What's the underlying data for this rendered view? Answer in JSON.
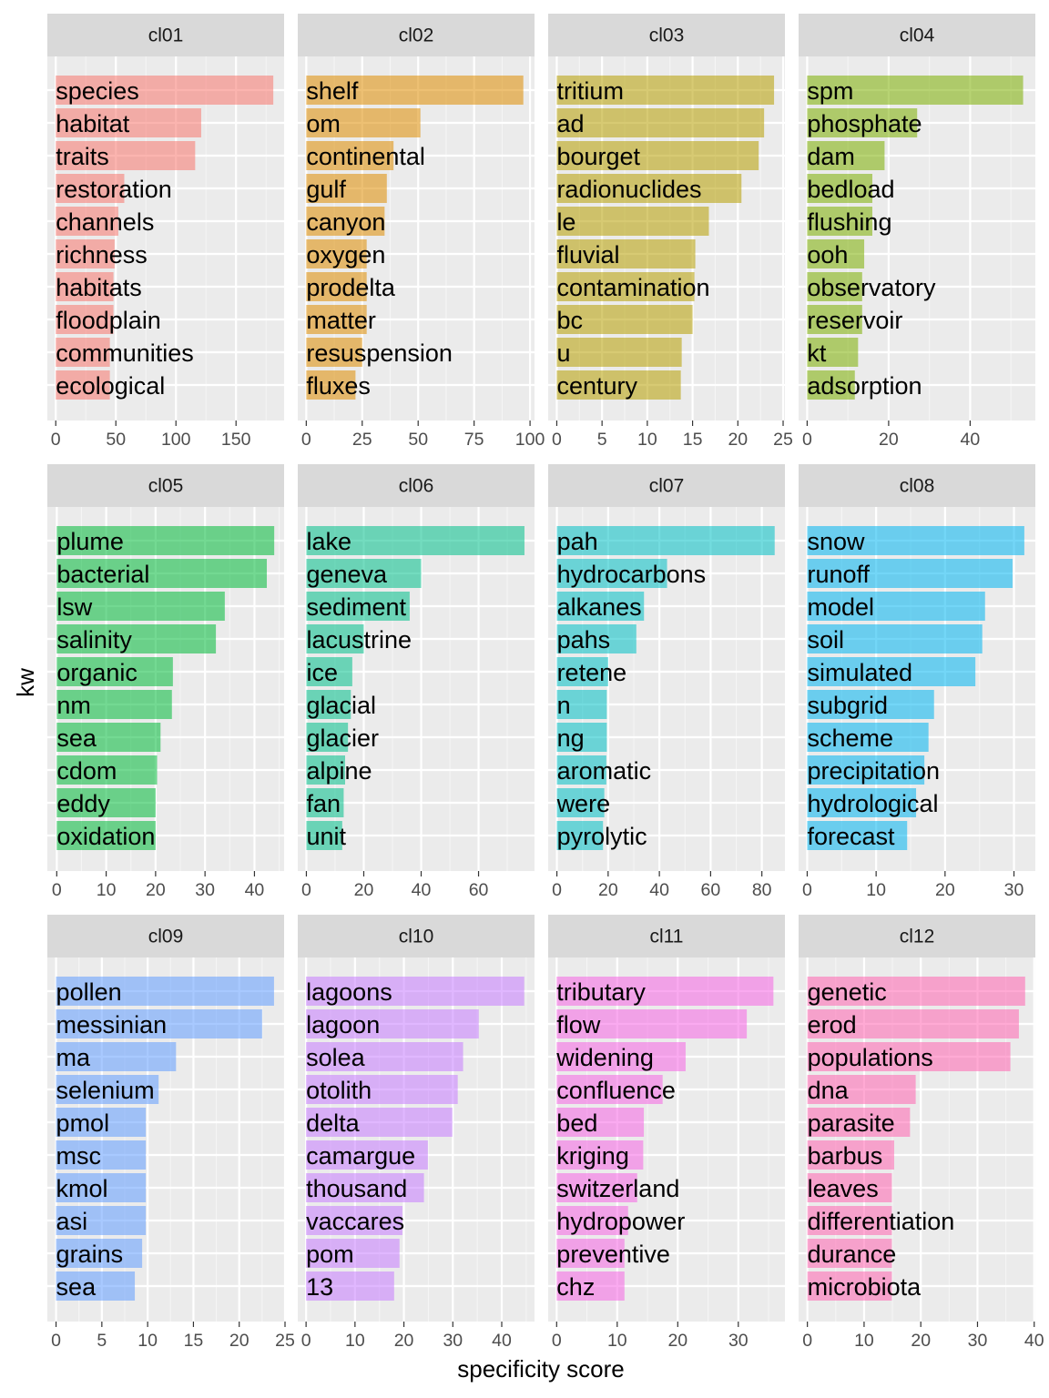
{
  "chart_data": {
    "type": "bar",
    "orientation": "horizontal",
    "xlabel": "specificity score",
    "ylabel": "kw",
    "grid": true,
    "facet_colors": [
      "#F8766D",
      "#DE8C00",
      "#B79F00",
      "#7CAE00",
      "#00BA38",
      "#00C08B",
      "#00BFC4",
      "#00B4F0",
      "#619CFF",
      "#C77CFF",
      "#F564E3",
      "#FF64B0"
    ],
    "panels": [
      {
        "name": "cl01",
        "xlim": [
          -7,
          190
        ],
        "xticks": [
          0,
          50,
          100,
          150
        ],
        "xtick_labels": [
          "0",
          "50",
          "100",
          "150"
        ],
        "categories": [
          "species",
          "habitat",
          "traits",
          "restoration",
          "channels",
          "richness",
          "habitats",
          "floodplain",
          "communities",
          "ecological"
        ],
        "values": [
          181,
          121,
          116,
          57,
          52,
          49,
          48,
          48,
          45,
          45
        ]
      },
      {
        "name": "cl02",
        "xlim": [
          -3.8,
          102
        ],
        "xticks": [
          0,
          25,
          50,
          75,
          100
        ],
        "xtick_labels": [
          "0",
          "25",
          "50",
          "75",
          "100"
        ],
        "categories": [
          "shelf",
          "om",
          "continental",
          "gulf",
          "canyon",
          "oxygen",
          "prodelta",
          "matter",
          "resuspension",
          "fluxes"
        ],
        "values": [
          97,
          51,
          39,
          36,
          35,
          27,
          27,
          27,
          25,
          22
        ]
      },
      {
        "name": "cl03",
        "xlim": [
          -0.95,
          25.2
        ],
        "xticks": [
          0,
          5,
          10,
          15,
          20,
          25
        ],
        "xtick_labels": [
          "0",
          "5",
          "10",
          "15",
          "20",
          "25"
        ],
        "categories": [
          "tritium",
          "ad",
          "bourget",
          "radionuclides",
          "le",
          "fluvial",
          "contamination",
          "bc",
          "u",
          "century"
        ],
        "values": [
          24,
          22.9,
          22.3,
          20.4,
          16.8,
          15.3,
          15.2,
          15.0,
          13.8,
          13.7
        ]
      },
      {
        "name": "cl04",
        "xlim": [
          -2.1,
          56
        ],
        "xticks": [
          0,
          20,
          40
        ],
        "xtick_labels": [
          "0",
          "20",
          "40"
        ],
        "categories": [
          "spm",
          "phosphate",
          "dam",
          "bedload",
          "flushing",
          "ooh",
          "observatory",
          "reservoir",
          "kt",
          "adsorption"
        ],
        "values": [
          53,
          27,
          19,
          16,
          16,
          14,
          13.5,
          13.5,
          12.5,
          11.7
        ]
      },
      {
        "name": "cl05",
        "xlim": [
          -1.9,
          46
        ],
        "xticks": [
          0,
          10,
          20,
          30,
          40
        ],
        "xtick_labels": [
          "0",
          "10",
          "20",
          "30",
          "40"
        ],
        "categories": [
          "plume",
          "bacterial",
          "lsw",
          "salinity",
          "organic",
          "nm",
          "sea",
          "cdom",
          "eddy",
          "oxidation"
        ],
        "values": [
          44,
          42.5,
          34,
          32.2,
          23.5,
          23.3,
          21,
          20.3,
          20,
          20
        ]
      },
      {
        "name": "cl06",
        "xlim": [
          -3,
          79.5
        ],
        "xticks": [
          0,
          20,
          40,
          60
        ],
        "xtick_labels": [
          "0",
          "20",
          "40",
          "60"
        ],
        "categories": [
          "lake",
          "geneva",
          "sediment",
          "lacustrine",
          "ice",
          "glacial",
          "glacier",
          "alpine",
          "fan",
          "unit"
        ],
        "values": [
          76,
          40,
          36,
          20,
          16,
          15.5,
          14.5,
          13.5,
          13,
          12.5
        ]
      },
      {
        "name": "cl07",
        "xlim": [
          -3.4,
          89
        ],
        "xticks": [
          0,
          20,
          40,
          60,
          80
        ],
        "xtick_labels": [
          "0",
          "20",
          "40",
          "60",
          "80"
        ],
        "categories": [
          "pah",
          "hydrocarbons",
          "alkanes",
          "pahs",
          "retene",
          "n",
          "ng",
          "aromatic",
          "were",
          "pyrolytic"
        ],
        "values": [
          85,
          43,
          34,
          31,
          20,
          19.5,
          19.5,
          19.3,
          18.5,
          18
        ]
      },
      {
        "name": "cl08",
        "xlim": [
          -1.25,
          33.1
        ],
        "xticks": [
          0,
          10,
          20,
          30
        ],
        "xtick_labels": [
          "0",
          "10",
          "20",
          "30"
        ],
        "categories": [
          "snow",
          "runoff",
          "model",
          "soil",
          "simulated",
          "subgrid",
          "scheme",
          "precipitation",
          "hydrological",
          "forecast"
        ],
        "values": [
          31.5,
          29.8,
          25.8,
          25.4,
          24.4,
          18.4,
          17.6,
          17.0,
          15.8,
          14.5
        ]
      },
      {
        "name": "cl09",
        "xlim": [
          -0.95,
          24.9
        ],
        "xticks": [
          0,
          5,
          10,
          15,
          20,
          25
        ],
        "xtick_labels": [
          "0",
          "5",
          "10",
          "15",
          "20",
          "25"
        ],
        "categories": [
          "pollen",
          "messinian",
          "ma",
          "selenium",
          "pmol",
          "msc",
          "kmol",
          "asi",
          "grains",
          "sea"
        ],
        "values": [
          23.8,
          22.5,
          13.1,
          11.2,
          9.8,
          9.8,
          9.8,
          9.8,
          9.4,
          8.6
        ]
      },
      {
        "name": "cl10",
        "xlim": [
          -1.7,
          46.7
        ],
        "xticks": [
          0,
          10,
          20,
          30,
          40
        ],
        "xtick_labels": [
          "0",
          "10",
          "20",
          "30",
          "40"
        ],
        "categories": [
          "lagoons",
          "lagoon",
          "solea",
          "otolith",
          "delta",
          "camargue",
          "thousand",
          "vaccares",
          "pom",
          "13"
        ],
        "values": [
          44.6,
          35.3,
          32.1,
          31,
          29.9,
          24.9,
          24.1,
          19.7,
          19.1,
          18
        ]
      },
      {
        "name": "cl11",
        "xlim": [
          -1.4,
          37.7
        ],
        "xticks": [
          0,
          10,
          20,
          30
        ],
        "xtick_labels": [
          "0",
          "10",
          "20",
          "30"
        ],
        "categories": [
          "tributary",
          "flow",
          "widening",
          "confluence",
          "bed",
          "kriging",
          "switzerland",
          "hydropower",
          "preventive",
          "chz"
        ],
        "values": [
          35.8,
          31.4,
          21.3,
          17.5,
          14.4,
          14.3,
          13.3,
          11.8,
          11.2,
          11.2
        ]
      },
      {
        "name": "cl12",
        "xlim": [
          -1.55,
          40.2
        ],
        "xticks": [
          0,
          10,
          20,
          30,
          40
        ],
        "xtick_labels": [
          "0",
          "10",
          "20",
          "30",
          "40"
        ],
        "categories": [
          "genetic",
          "erod",
          "populations",
          "dna",
          "parasite",
          "barbus",
          "leaves",
          "differentiation",
          "durance",
          "microbiota"
        ],
        "values": [
          38.4,
          37.3,
          35.8,
          19.1,
          18.1,
          15.3,
          14.9,
          14.9,
          14.9,
          14.9
        ]
      }
    ]
  }
}
